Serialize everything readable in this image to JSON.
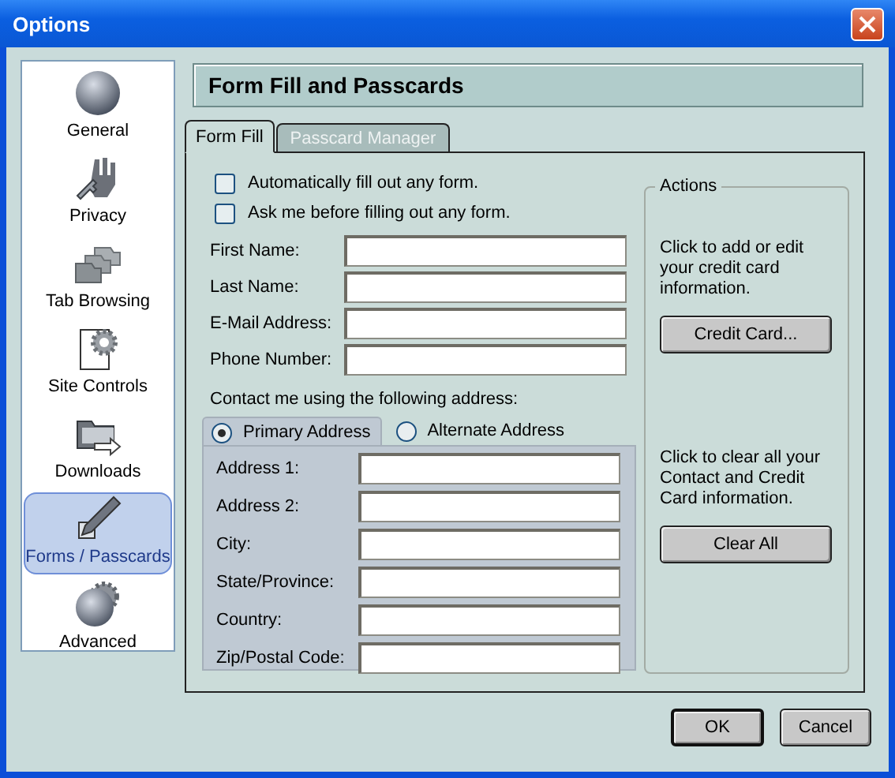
{
  "window": {
    "title": "Options"
  },
  "sidebar": {
    "items": [
      {
        "label": "General",
        "selected": false
      },
      {
        "label": "Privacy",
        "selected": false
      },
      {
        "label": "Tab Browsing",
        "selected": false
      },
      {
        "label": "Site Controls",
        "selected": false
      },
      {
        "label": "Downloads",
        "selected": false
      },
      {
        "label": "Forms / Passcards",
        "selected": true
      },
      {
        "label": "Advanced",
        "selected": false
      }
    ]
  },
  "header": {
    "title": "Form Fill and Passcards"
  },
  "tabs": [
    {
      "label": "Form Fill",
      "selected": true
    },
    {
      "label": "Passcard Manager",
      "selected": false
    }
  ],
  "options": [
    {
      "label": "Automatically fill out any form.",
      "checked": false
    },
    {
      "label": "Ask me before filling out any form.",
      "checked": false
    }
  ],
  "personal_fields": [
    {
      "label": "First Name:"
    },
    {
      "label": "Last Name:"
    },
    {
      "label": "E-Mail Address:"
    },
    {
      "label": "Phone Number:"
    }
  ],
  "contact_label": "Contact me using the following address:",
  "address_tabs": [
    {
      "label": "Primary Address",
      "selected": true
    },
    {
      "label": "Alternate Address",
      "selected": false
    }
  ],
  "address_fields": [
    {
      "label": "Address 1:"
    },
    {
      "label": "Address 2:"
    },
    {
      "label": "City:"
    },
    {
      "label": "State/Province:"
    },
    {
      "label": "Country:"
    },
    {
      "label": "Zip/Postal Code:"
    }
  ],
  "actions": {
    "title": "Actions",
    "groups": [
      {
        "description": "Click to add or edit your credit card information.",
        "button": "Credit Card..."
      },
      {
        "description": "Click to clear all your Contact and Credit Card information.",
        "button": "Clear All"
      }
    ]
  },
  "buttons": [
    {
      "label": "OK",
      "default": true
    },
    {
      "label": "Cancel",
      "default": false
    }
  ]
}
